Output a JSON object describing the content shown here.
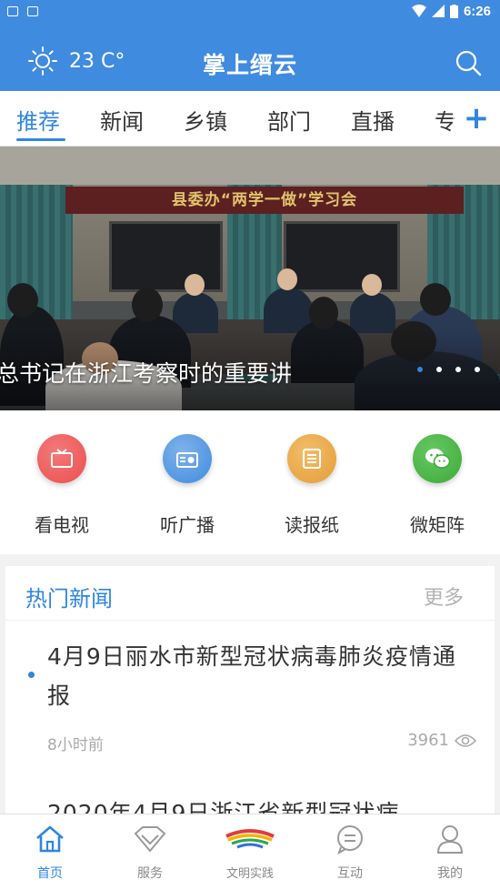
{
  "status_bar": {
    "time": "6:26"
  },
  "header": {
    "weather_temp": "23 C°",
    "title": "掌上缙云"
  },
  "tabs": [
    {
      "label": "推荐",
      "active": true
    },
    {
      "label": "新闻",
      "active": false
    },
    {
      "label": "乡镇",
      "active": false
    },
    {
      "label": "部门",
      "active": false
    },
    {
      "label": "直播",
      "active": false
    },
    {
      "label": "专",
      "active": false
    }
  ],
  "tab_add_label": "+",
  "banner": {
    "caption": "总书记在浙江考察时的重要讲",
    "sign_text": "县委办“两学一做”学习会",
    "slide_count": 4,
    "active_slide": 1
  },
  "quick_links": [
    {
      "label": "看电视",
      "icon": "tv-icon",
      "color": "#e9504f"
    },
    {
      "label": "听广播",
      "icon": "radio-icon",
      "color": "#3f8be0"
    },
    {
      "label": "读报纸",
      "icon": "newspaper-icon",
      "color": "#e59d36"
    },
    {
      "label": "微矩阵",
      "icon": "wechat-icon",
      "color": "#3daa39"
    }
  ],
  "hot_news": {
    "title": "热门新闻",
    "more_label": "更多",
    "items": [
      {
        "title": "4月9日丽水市新型冠状病毒肺炎疫情通报",
        "time": "8小时前",
        "views": "3961"
      },
      {
        "title": "2020年4月9日浙江省新型冠状病",
        "time": "",
        "views": ""
      }
    ]
  },
  "tabbar": [
    {
      "label": "首页",
      "icon": "home-icon",
      "active": true
    },
    {
      "label": "服务",
      "icon": "diamond-icon",
      "active": false
    },
    {
      "label": "文明实践",
      "icon": "civilization-logo-icon",
      "active": false
    },
    {
      "label": "互动",
      "icon": "chat-icon",
      "active": false
    },
    {
      "label": "我的",
      "icon": "user-icon",
      "active": false
    }
  ],
  "colors": {
    "brand": "#3f8be0",
    "accent": "#2f86e0"
  }
}
